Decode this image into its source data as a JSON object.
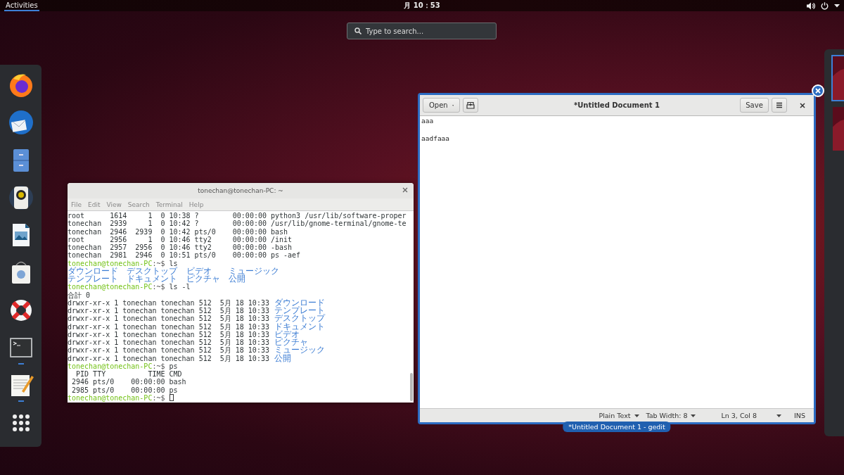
{
  "top_bar": {
    "activities": {
      "label": "Activities",
      "selected": true
    },
    "clock": "月 10：53"
  },
  "search": {
    "placeholder": "Type to search..."
  },
  "dock": {
    "items": [
      {
        "kind": "firefox",
        "running": false
      },
      {
        "kind": "mail",
        "running": false
      },
      {
        "kind": "files",
        "running": false
      },
      {
        "kind": "music",
        "running": false
      },
      {
        "kind": "impress",
        "running": false
      },
      {
        "kind": "software",
        "running": false
      },
      {
        "kind": "help",
        "running": false
      },
      {
        "kind": "terminal",
        "running": true
      },
      {
        "kind": "editor",
        "running": true
      },
      {
        "kind": "apps",
        "running": false
      }
    ]
  },
  "terminal": {
    "title": "tonechan@tonechan-PC: ~",
    "hovered": false,
    "menu": [
      "File",
      "Edit",
      "View",
      "Search",
      "Terminal",
      "Help"
    ],
    "lines": [
      {
        "kind": "text",
        "text": "root      1614     1  0 10:38 ?        00:00:00 python3 /usr/lib/software-proper"
      },
      {
        "kind": "text",
        "text": "tonechan  2939     1  0 10:42 ?        00:00:00 /usr/lib/gnome-terminal/gnome-te"
      },
      {
        "kind": "text",
        "text": "tonechan  2946  2939  0 10:42 pts/0    00:00:00 bash"
      },
      {
        "kind": "text",
        "text": "root      2956     1  0 10:46 tty2     00:00:00 /init"
      },
      {
        "kind": "text",
        "text": "tonechan  2957  2956  0 10:46 tty2     00:00:00 -bash"
      },
      {
        "kind": "text",
        "text": "tonechan  2981  2946  0 10:51 pts/0    00:00:00 ps -aef"
      },
      {
        "kind": "prompt",
        "user": "tonechan@tonechan-PC",
        "path": ":~$",
        "command": "ls"
      },
      {
        "kind": "columns",
        "items": [
          "ダウンロード",
          "デスクトップ",
          "ビデオ",
          "ミュージック"
        ]
      },
      {
        "kind": "columns",
        "items": [
          "テンプレート",
          "ドキュメント",
          "ピクチャ",
          "公開"
        ]
      },
      {
        "kind": "prompt",
        "user": "tonechan@tonechan-PC",
        "path": ":~$",
        "command": "ls -l"
      },
      {
        "kind": "text",
        "text": "合計 0"
      },
      {
        "kind": "listing",
        "info": "drwxr-xr-x 1 tonechan tonechan 512  5月 18 10:33",
        "name": "ダウンロード"
      },
      {
        "kind": "listing",
        "info": "drwxr-xr-x 1 tonechan tonechan 512  5月 18 10:33",
        "name": "テンプレート"
      },
      {
        "kind": "listing",
        "info": "drwxr-xr-x 1 tonechan tonechan 512  5月 18 10:33",
        "name": "デスクトップ"
      },
      {
        "kind": "listing",
        "info": "drwxr-xr-x 1 tonechan tonechan 512  5月 18 10:33",
        "name": "ドキュメント"
      },
      {
        "kind": "listing",
        "info": "drwxr-xr-x 1 tonechan tonechan 512  5月 18 10:33",
        "name": "ビデオ"
      },
      {
        "kind": "listing",
        "info": "drwxr-xr-x 1 tonechan tonechan 512  5月 18 10:33",
        "name": "ピクチャ"
      },
      {
        "kind": "listing",
        "info": "drwxr-xr-x 1 tonechan tonechan 512  5月 18 10:33",
        "name": "ミュージック"
      },
      {
        "kind": "listing",
        "info": "drwxr-xr-x 1 tonechan tonechan 512  5月 18 10:33",
        "name": "公開"
      },
      {
        "kind": "prompt",
        "user": "tonechan@tonechan-PC",
        "path": ":~$",
        "command": "ps"
      },
      {
        "kind": "text",
        "text": "  PID TTY          TIME CMD"
      },
      {
        "kind": "text",
        "text": " 2946 pts/0    00:00:00 bash"
      },
      {
        "kind": "text",
        "text": " 2985 pts/0    00:00:00 ps"
      },
      {
        "kind": "prompt",
        "user": "tonechan@tonechan-PC",
        "path": ":~$"
      }
    ],
    "cursor": true
  },
  "editor": {
    "title": "*Untitled Document 1",
    "hovered": true,
    "caption": "*Untitled Document 1 - gedit",
    "open_button": "Open",
    "save_button": "Save",
    "content": "aaa\n\naadfaaa",
    "status": [
      {
        "kind": "dropdown",
        "text": "Plain Text"
      },
      {
        "kind": "dropdown",
        "text": "Tab Width: 8"
      },
      {
        "kind": "label",
        "text": "Ln 3, Col 8"
      },
      {
        "kind": "caret"
      },
      {
        "kind": "label",
        "text": "INS"
      }
    ]
  },
  "workspaces": [
    {
      "selected": true
    },
    {
      "selected": false
    }
  ]
}
